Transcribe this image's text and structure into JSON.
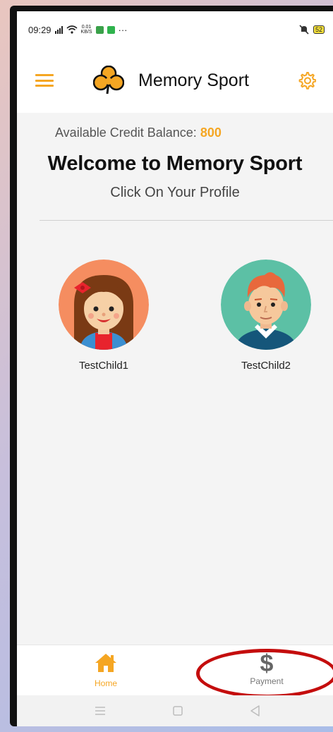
{
  "status_bar": {
    "time": "09:29",
    "net_speed_top": "0.01",
    "net_speed_bottom": "KB/S",
    "more": "···",
    "battery": "52"
  },
  "app_bar": {
    "title": "Memory Sport",
    "accent_color": "#f5a623",
    "icons": [
      "hamburger-menu-icon",
      "clover-logo-icon",
      "gear-icon"
    ]
  },
  "main": {
    "credit_label": "Available Credit Balance:",
    "credit_value": "800",
    "welcome": "Welcome to Memory Sport",
    "subtitle": "Click On Your Profile",
    "profiles": [
      {
        "name": "TestChild1",
        "avatar": "girl-avatar-icon",
        "bg": "#f58d60"
      },
      {
        "name": "TestChild2",
        "avatar": "boy-avatar-icon",
        "bg": "#5cc0a5"
      }
    ]
  },
  "bottom_nav": {
    "items": [
      {
        "label": "Home",
        "icon": "home-icon",
        "active": true
      },
      {
        "label": "Payment",
        "icon": "dollar-icon",
        "active": false
      }
    ],
    "highlight_color": "#c40d0d"
  },
  "system_nav": [
    "menu-icon",
    "square-icon",
    "back-triangle-icon"
  ]
}
